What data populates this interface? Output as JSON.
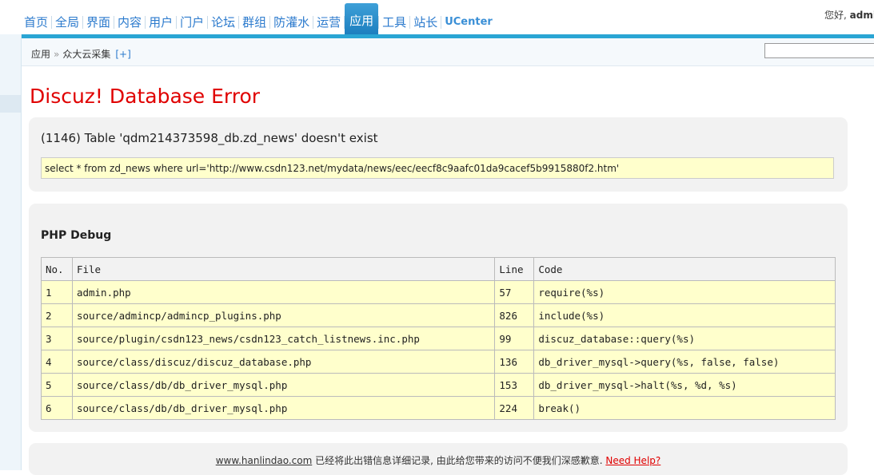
{
  "nav": {
    "items": [
      "首页",
      "全局",
      "界面",
      "内容",
      "用户",
      "门户",
      "论坛",
      "群组",
      "防灌水",
      "运营",
      "应用",
      "工具",
      "站长",
      "UCenter"
    ],
    "active": "应用"
  },
  "user": {
    "greeting": "您好,",
    "name": "admi"
  },
  "breadcrumb": {
    "root": "应用",
    "sep": "»",
    "current": "众大云采集",
    "add": "[+]"
  },
  "error": {
    "title": "Discuz! Database Error",
    "message": "(1146) Table 'qdm214373598_db.zd_news' doesn't exist",
    "sql": "select * from zd_news where url='http://www.csdn123.net/mydata/news/eec/eecf8c9aafc01da9cacef5b9915880f2.htm'"
  },
  "debug": {
    "title": "PHP Debug",
    "columns": [
      "No.",
      "File",
      "Line",
      "Code"
    ],
    "rows": [
      [
        "1",
        "admin.php",
        "57",
        "require(%s)"
      ],
      [
        "2",
        "source/admincp/admincp_plugins.php",
        "826",
        "include(%s)"
      ],
      [
        "3",
        "source/plugin/csdn123_news/csdn123_catch_listnews.inc.php",
        "99",
        "discuz_database::query(%s)"
      ],
      [
        "4",
        "source/class/discuz/discuz_database.php",
        "136",
        "db_driver_mysql->query(%s, false, false)"
      ],
      [
        "5",
        "source/class/db/db_driver_mysql.php",
        "153",
        "db_driver_mysql->halt(%s, %d, %s)"
      ],
      [
        "6",
        "source/class/db/db_driver_mysql.php",
        "224",
        "break()"
      ]
    ]
  },
  "footer": {
    "site": "www.hanlindao.com",
    "text": " 已经将此出错信息详细记录, 由此给您带来的访问不便我们深感歉意. ",
    "help": "Need Help?"
  }
}
